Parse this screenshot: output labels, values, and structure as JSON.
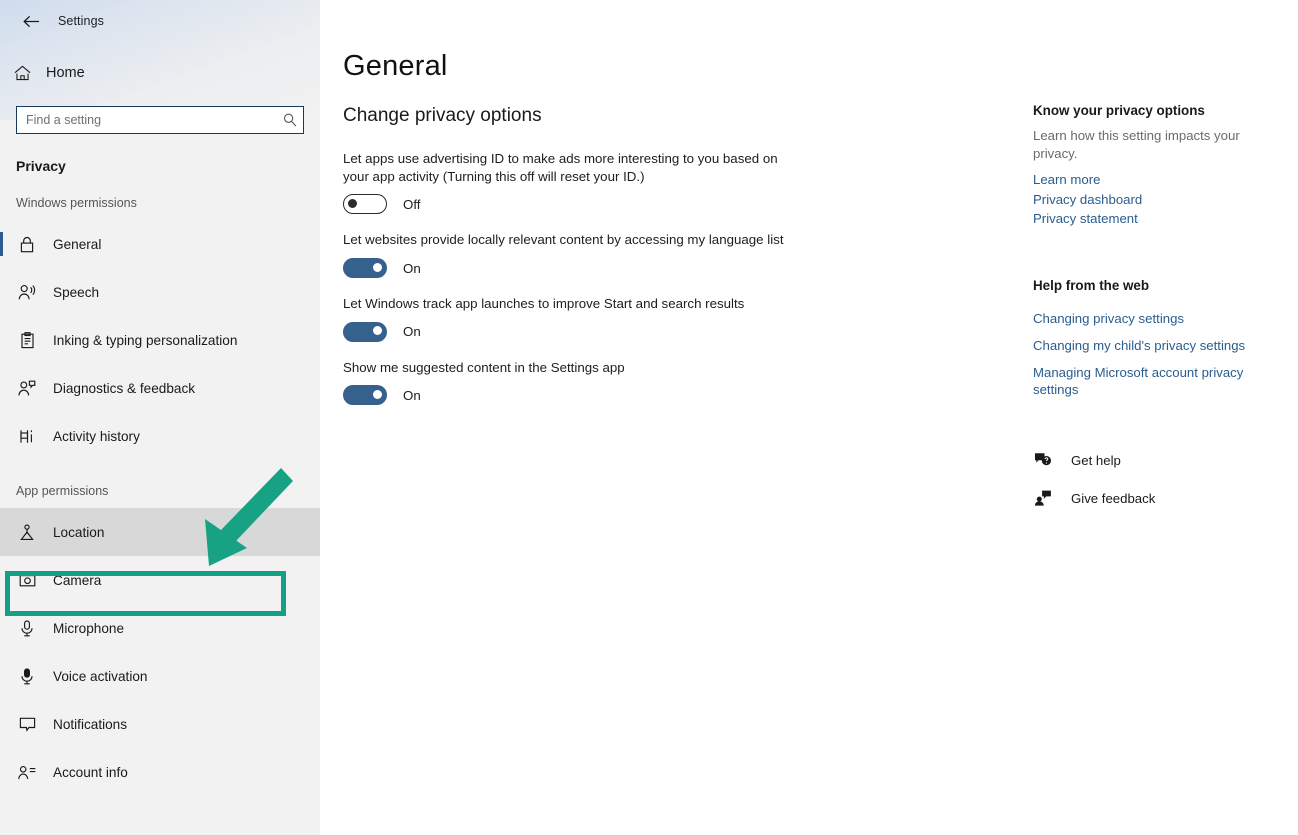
{
  "window": {
    "app_title": "Settings",
    "back_icon": "back-arrow-icon",
    "controls": {
      "minimize": "minimize-icon",
      "maximize": "maximize-icon",
      "close": "close-icon"
    }
  },
  "sidebar": {
    "home_label": "Home",
    "home_icon": "home-icon",
    "search": {
      "placeholder": "Find a setting",
      "value": "",
      "icon": "search-icon"
    },
    "category_title": "Privacy",
    "groups": [
      {
        "label": "Windows permissions",
        "items": [
          {
            "label": "General",
            "icon": "lock-icon",
            "selected": true,
            "hovered": false
          },
          {
            "label": "Speech",
            "icon": "speech-person-icon",
            "selected": false,
            "hovered": false
          },
          {
            "label": "Inking & typing personalization",
            "icon": "clipboard-pen-icon",
            "selected": false,
            "hovered": false
          },
          {
            "label": "Diagnostics & feedback",
            "icon": "person-feedback-icon",
            "selected": false,
            "hovered": false
          },
          {
            "label": "Activity history",
            "icon": "activity-history-icon",
            "selected": false,
            "hovered": false
          }
        ]
      },
      {
        "label": "App permissions",
        "items": [
          {
            "label": "Location",
            "icon": "location-pin-icon",
            "selected": false,
            "hovered": true
          },
          {
            "label": "Camera",
            "icon": "camera-icon",
            "selected": false,
            "hovered": false
          },
          {
            "label": "Microphone",
            "icon": "microphone-icon",
            "selected": false,
            "hovered": false
          },
          {
            "label": "Voice activation",
            "icon": "voice-activation-icon",
            "selected": false,
            "hovered": false
          },
          {
            "label": "Notifications",
            "icon": "notification-icon",
            "selected": false,
            "hovered": false
          },
          {
            "label": "Account info",
            "icon": "account-info-icon",
            "selected": false,
            "hovered": false
          }
        ]
      }
    ]
  },
  "main": {
    "page_title": "General",
    "section_title": "Change privacy options",
    "settings": [
      {
        "description": "Let apps use advertising ID to make ads more interesting to you based on your app activity (Turning this off will reset your ID.)",
        "state": "Off",
        "on": false
      },
      {
        "description": "Let websites provide locally relevant content by accessing my language list",
        "state": "On",
        "on": true
      },
      {
        "description": "Let Windows track app launches to improve Start and search results",
        "state": "On",
        "on": true
      },
      {
        "description": "Show me suggested content in the Settings app",
        "state": "On",
        "on": true
      }
    ]
  },
  "right_panel": {
    "privacy": {
      "heading": "Know your privacy options",
      "body": "Learn how this setting impacts your privacy.",
      "links": [
        "Learn more",
        "Privacy dashboard",
        "Privacy statement"
      ]
    },
    "help_web": {
      "heading": "Help from the web",
      "links": [
        "Changing privacy settings",
        "Changing my child's privacy settings",
        "Managing Microsoft account privacy settings"
      ]
    },
    "actions": [
      {
        "label": "Get help",
        "icon": "get-help-icon"
      },
      {
        "label": "Give feedback",
        "icon": "give-feedback-icon"
      }
    ]
  },
  "annotations": {
    "highlight_color": "#13a085",
    "arrow_color": "#17a383",
    "highlighted_item": "Location"
  }
}
